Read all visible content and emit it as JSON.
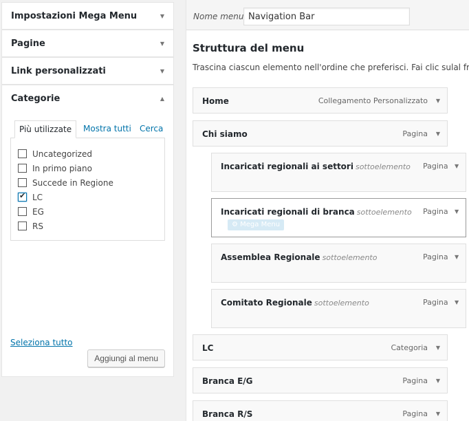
{
  "left": {
    "sections": [
      {
        "label": "Impostazioni Mega Menu",
        "expanded": false
      },
      {
        "label": "Pagine",
        "expanded": false
      },
      {
        "label": "Link personalizzati",
        "expanded": false
      },
      {
        "label": "Categorie",
        "expanded": true
      }
    ],
    "tabs": [
      "Più utilizzate",
      "Mostra tutti",
      "Cerca"
    ],
    "active_tab": "Più utilizzate",
    "categories": [
      {
        "label": "Uncategorized",
        "checked": false
      },
      {
        "label": "In primo piano",
        "checked": false
      },
      {
        "label": "Succede in Regione",
        "checked": false
      },
      {
        "label": "LC",
        "checked": true
      },
      {
        "label": "EG",
        "checked": false
      },
      {
        "label": "RS",
        "checked": false
      }
    ],
    "select_all": "Seleziona tutto",
    "add_button": "Aggiungi al menu"
  },
  "menu": {
    "name_label": "Nome menu",
    "name_value": "Navigation Bar",
    "structure_title": "Struttura del menu",
    "structure_desc": "Trascina ciascun elemento nell'ordine che preferisci. Fai clic sulal freccia",
    "subitem_label": "sottoelemento",
    "mega_menu_badge": "⚙ Mega Menu",
    "items": [
      {
        "title": "Home",
        "type": "Collegamento Personalizzato",
        "depth": 0
      },
      {
        "title": "Chi siamo",
        "type": "Pagina",
        "depth": 0
      },
      {
        "title": "Incaricati regionali ai settori",
        "type": "Pagina",
        "depth": 1
      },
      {
        "title": "Incaricati regionali di branca",
        "type": "Pagina",
        "depth": 1,
        "focused": true
      },
      {
        "title": "Assemblea Regionale",
        "type": "Pagina",
        "depth": 1
      },
      {
        "title": "Comitato Regionale",
        "type": "Pagina",
        "depth": 1
      },
      {
        "title": "LC",
        "type": "Categoria",
        "depth": 0
      },
      {
        "title": "Branca E/G",
        "type": "Pagina",
        "depth": 0
      },
      {
        "title": "Branca R/S",
        "type": "Pagina",
        "depth": 0
      }
    ]
  },
  "icons": {
    "collapsed": "triangle-down",
    "expanded": "triangle-up"
  }
}
